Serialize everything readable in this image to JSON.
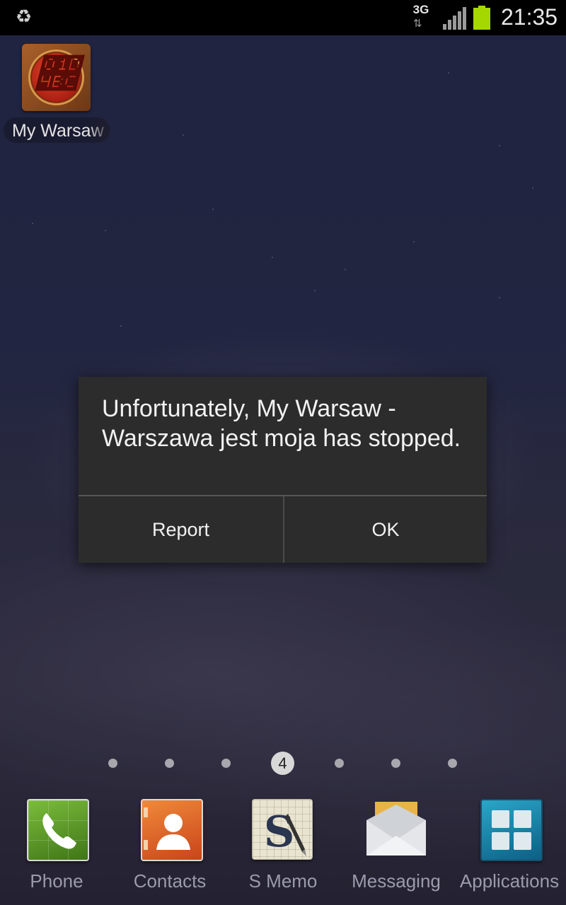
{
  "status_bar": {
    "network_type": "3G",
    "time": "21:35",
    "icons": [
      "recycle-icon",
      "data-transfer-icon",
      "signal-strength-icon",
      "battery-icon"
    ],
    "battery_color": "#a5d800"
  },
  "home": {
    "app_shortcut": {
      "label": "My Warsaw",
      "icon": "my-warsaw-app-icon"
    },
    "page_indicator": {
      "current_page": "4",
      "total_pages": 7
    },
    "dock": [
      {
        "label": "Phone",
        "icon": "phone-icon"
      },
      {
        "label": "Contacts",
        "icon": "contacts-icon"
      },
      {
        "label": "S Memo",
        "icon": "s-memo-icon"
      },
      {
        "label": "Messaging",
        "icon": "messaging-icon"
      },
      {
        "label": "Applications",
        "icon": "applications-icon"
      }
    ]
  },
  "dialog": {
    "message": "Unfortunately, My Warsaw - Warszawa jest moja has stopped.",
    "buttons": {
      "report": "Report",
      "ok": "OK"
    }
  },
  "colors": {
    "dialog_background": "#2c2c2c",
    "wallpaper": "#2c3054",
    "status_bar": "#000000"
  }
}
